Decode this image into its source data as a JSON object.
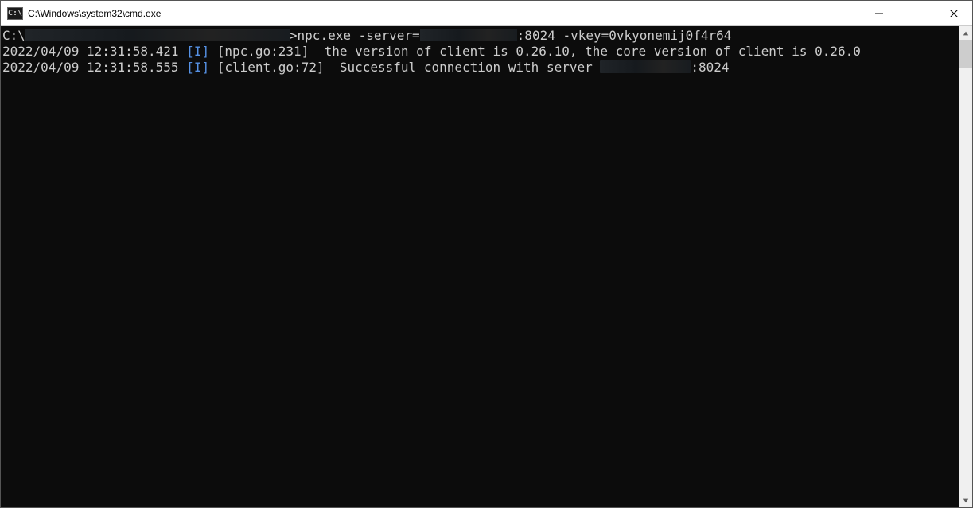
{
  "window": {
    "title": "C:\\Windows\\system32\\cmd.exe",
    "icon_label": "C:\\"
  },
  "terminal": {
    "lines": [
      {
        "prefix": "C:\\",
        "redact1_w": 332,
        "mid": ">npc.exe -server=",
        "redact2_w": 122,
        "suffix": ":8024 -vkey=0vkyonemij0f4r64"
      },
      {
        "ts": "2022/04/09 12:31:58.421 ",
        "tag": "[I]",
        "after_tag": " [npc.go:231]  the version of client is 0.26.10, the core version of client is 0.26.0"
      },
      {
        "ts": "2022/04/09 12:31:58.555 ",
        "tag": "[I]",
        "after_tag": " [client.go:72]  Successful connection with server ",
        "redact_w": 114,
        "suffix": ":8024"
      }
    ]
  }
}
